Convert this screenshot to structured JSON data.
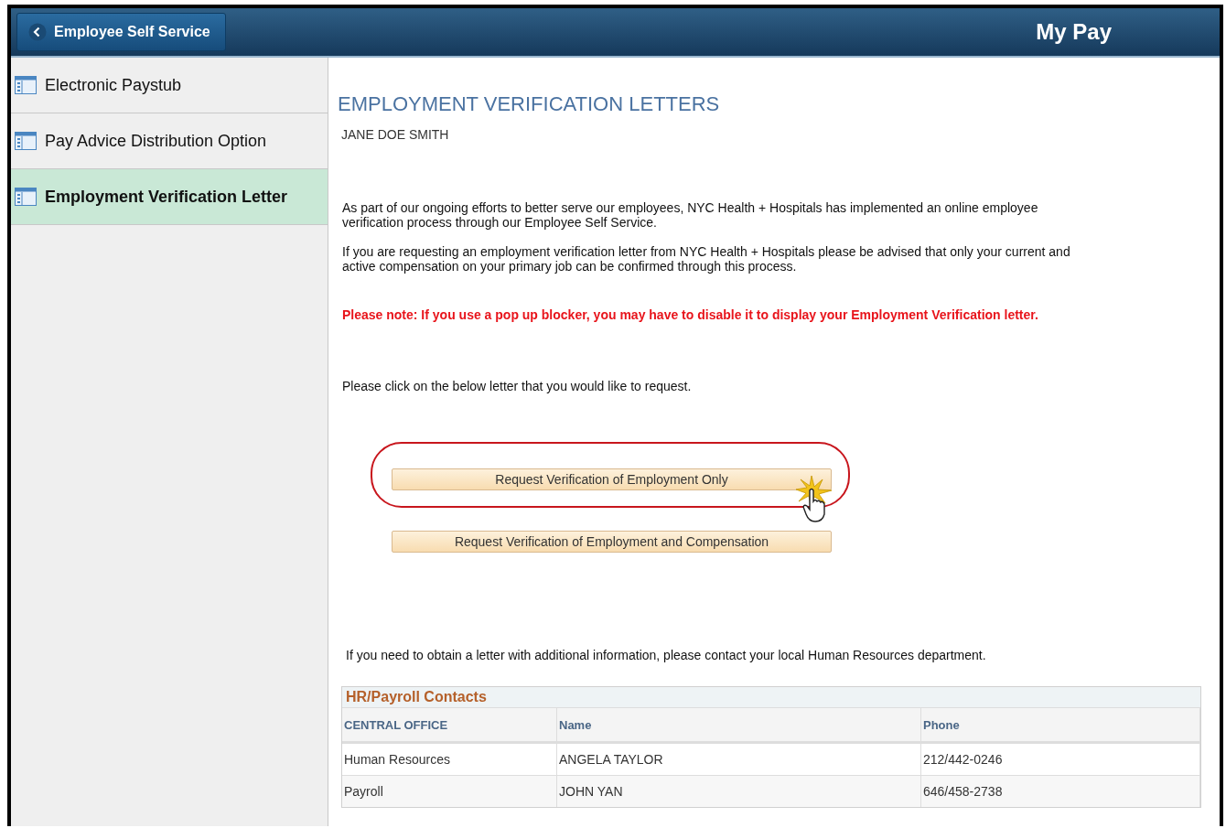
{
  "header": {
    "back_button": "Employee Self Service",
    "title": "My Pay"
  },
  "sidebar": {
    "items": [
      {
        "label": "Electronic Paystub",
        "selected": false
      },
      {
        "label": "Pay Advice Distribution Option",
        "selected": false
      },
      {
        "label": "Employment Verification Letter",
        "selected": true
      }
    ]
  },
  "content": {
    "title": "EMPLOYMENT VERIFICATION LETTERS",
    "employee_name": "JANE DOE SMITH",
    "paragraphs": [
      "As part of our ongoing efforts to better serve our employees, NYC Health + Hospitals has implemented an online employee verification process through our Employee Self Service.",
      "If you are requesting an employment verification letter from NYC Health + Hospitals please be advised that only your current and active compensation on your primary job can be confirmed through this process."
    ],
    "note": "Please note: If you use a pop up blocker, you may have to disable it to display your Employment Verification letter.",
    "instruction": "Please click on the below letter that you would like to request.",
    "buttons": [
      {
        "label": "Request Verification of Employment Only",
        "highlighted": true
      },
      {
        "label": "Request Verification of Employment and Compensation",
        "highlighted": false
      }
    ],
    "contact_note": "If you need to obtain a letter with additional information, please contact your local Human Resources department.",
    "contacts": {
      "title": "HR/Payroll Contacts",
      "columns": [
        "CENTRAL OFFICE",
        "Name",
        "Phone"
      ],
      "rows": [
        [
          "Human Resources",
          "ANGELA TAYLOR",
          "212/442-0246"
        ],
        [
          "Payroll",
          "JOHN YAN",
          "646/458-2738"
        ]
      ]
    }
  }
}
